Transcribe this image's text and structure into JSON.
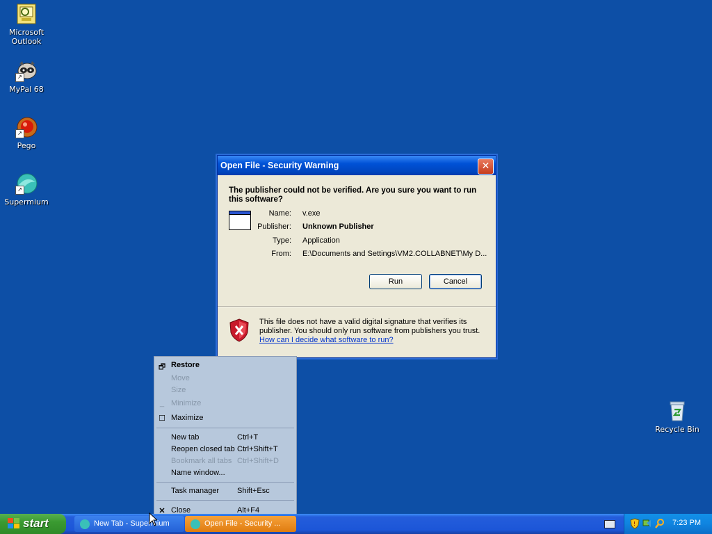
{
  "desktop": {
    "icons": [
      {
        "label": "Microsoft Outlook"
      },
      {
        "label": "MyPal 68"
      },
      {
        "label": "Pego"
      },
      {
        "label": "Supermium"
      },
      {
        "label": "Recycle Bin"
      }
    ]
  },
  "dialog": {
    "title": "Open File - Security Warning",
    "close_label": "✕",
    "heading": "The publisher could not be verified.  Are you sure you want to run this software?",
    "fields": [
      {
        "label": "Name:",
        "value": "v.exe"
      },
      {
        "label": "Publisher:",
        "value": "Unknown Publisher"
      },
      {
        "label": "Type:",
        "value": "Application"
      },
      {
        "label": "From:",
        "value": "E:\\Documents and Settings\\VM2.COLLABNET\\My D..."
      }
    ],
    "run_label": "Run",
    "cancel_label": "Cancel",
    "warning_text": "This file does not have a valid digital signature that verifies its publisher.  You should only run software from publishers you trust.",
    "warning_link": "How can I decide what software to run?"
  },
  "context_menu": {
    "items": [
      {
        "label": "Restore",
        "shortcut": "",
        "icon": "restore-icon"
      },
      {
        "label": "Move",
        "shortcut": ""
      },
      {
        "label": "Size",
        "shortcut": ""
      },
      {
        "label": "Minimize",
        "shortcut": "",
        "icon": "minimize-icon"
      },
      {
        "label": "Maximize",
        "shortcut": "",
        "icon": "maximize-icon"
      },
      {
        "label": "New tab",
        "shortcut": "Ctrl+T"
      },
      {
        "label": "Reopen closed tab",
        "shortcut": "Ctrl+Shift+T"
      },
      {
        "label": "Bookmark all tabs",
        "shortcut": "Ctrl+Shift+D"
      },
      {
        "label": "Name window...",
        "shortcut": ""
      },
      {
        "label": "Task manager",
        "shortcut": "Shift+Esc"
      },
      {
        "label": "Close",
        "shortcut": "Alt+F4",
        "icon": "close-icon"
      }
    ]
  },
  "taskbar": {
    "start_label": "start",
    "tasks": [
      {
        "label": "New Tab - Supermium"
      },
      {
        "label": "Open File - Security ..."
      }
    ],
    "clock": "7:23 PM"
  },
  "colors": {
    "desktop": "#0d4fa6",
    "titlebar": "#0052d6",
    "start": "#3a9a31",
    "active_task": "#f08a1a"
  }
}
